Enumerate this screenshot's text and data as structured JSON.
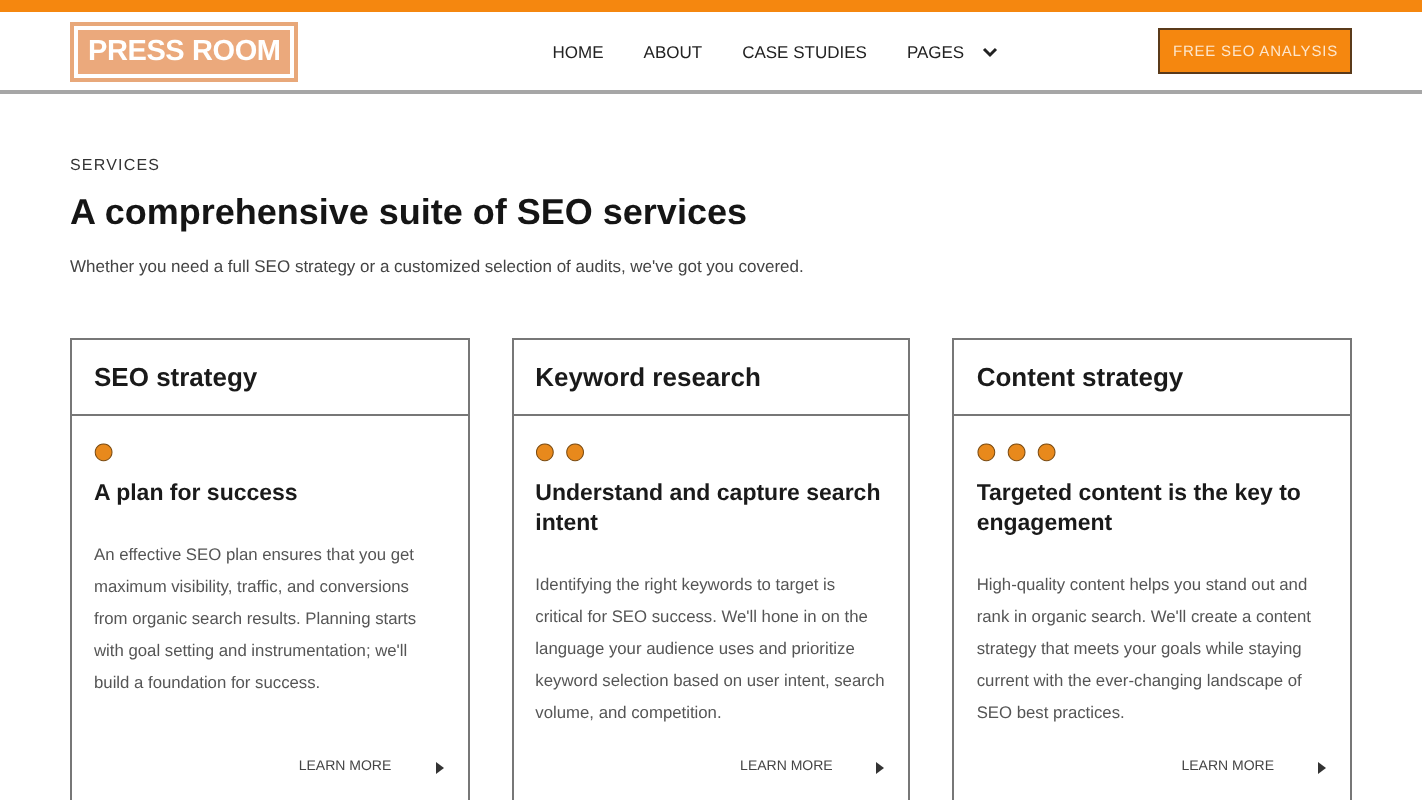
{
  "header": {
    "logo": "PRESS ROOM",
    "nav": [
      {
        "label": "HOME",
        "has_menu": false
      },
      {
        "label": "ABOUT",
        "has_menu": false
      },
      {
        "label": "CASE STUDIES",
        "has_menu": false
      },
      {
        "label": "PAGES",
        "has_menu": true
      }
    ],
    "cta": "FREE SEO ANALYSIS"
  },
  "section": {
    "eyebrow": "SERVICES",
    "title": "A comprehensive suite of SEO services",
    "intro": "Whether you need a full SEO strategy or a customized selection of audits, we've got you covered."
  },
  "cards": [
    {
      "title": "SEO strategy",
      "markers": "●",
      "heading": "A plan for success",
      "body": "An effective SEO plan ensures that you get maximum visibility, traffic, and conversions from organic search results. Planning starts with goal setting and instrumentation; we'll build a foundation for success.",
      "link": "LEARN MORE"
    },
    {
      "title": "Keyword research",
      "markers": "● ●",
      "heading": "Understand and capture search intent",
      "body": "Identifying the right keywords to target is critical for SEO success. We'll hone in on the language your audience uses and prioritize keyword selection based on user intent, search volume, and competition.",
      "link": "LEARN MORE"
    },
    {
      "title": "Content strategy",
      "markers": "● ● ●",
      "heading": "Targeted content is the key to engagement",
      "body": "High-quality content helps you stand out and rank in organic search. We'll create a content strategy that meets your goals while staying current with the ever-changing landscape of SEO best practices.",
      "link": "LEARN MORE"
    }
  ]
}
